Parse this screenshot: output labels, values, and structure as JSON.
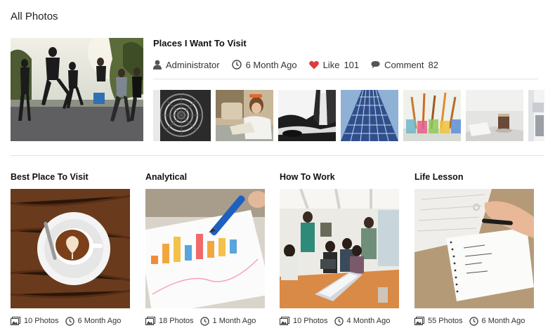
{
  "page": {
    "title": "All Photos"
  },
  "featured": {
    "title": "Places I Want To Visit",
    "author": "Administrator",
    "age": "6 Month Ago",
    "like_label": "Like",
    "like_count": "101",
    "comment_label": "Comment",
    "comment_count": "82",
    "thumbnails": [
      "spiral-staircase",
      "girl-reading",
      "waterfall-rocks",
      "skyscraper",
      "paint-brushes",
      "coffee-book",
      "partial-photo"
    ]
  },
  "albums": [
    {
      "title": "Best Place To Visit",
      "photos": "10 Photos",
      "age": "6 Month Ago",
      "cover": "latte-art"
    },
    {
      "title": "Analytical",
      "photos": "18 Photos",
      "age": "1 Month Ago",
      "cover": "bar-chart-pen"
    },
    {
      "title": "How To Work",
      "photos": "10 Photos",
      "age": "4 Month Ago",
      "cover": "team-meeting"
    },
    {
      "title": "Life Lesson",
      "photos": "55 Photos",
      "age": "6 Month Ago",
      "cover": "notebook-writing"
    }
  ],
  "colors": {
    "heart": "#e0393e",
    "divider": "#e2e2e2",
    "text": "#222222"
  }
}
